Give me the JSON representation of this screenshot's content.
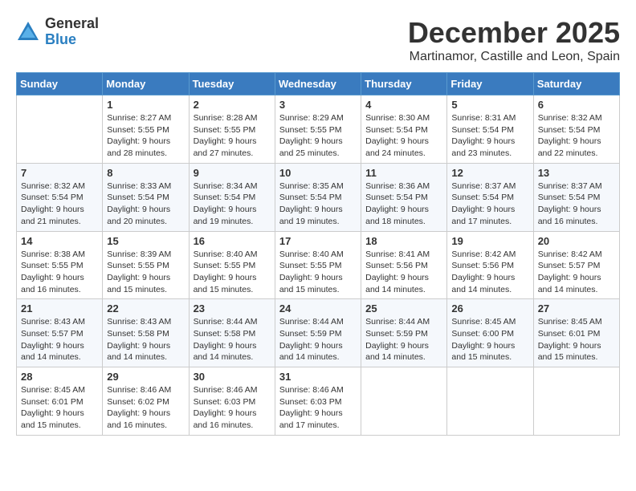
{
  "logo": {
    "general": "General",
    "blue": "Blue"
  },
  "header": {
    "month": "December 2025",
    "location": "Martinamor, Castille and Leon, Spain"
  },
  "days_of_week": [
    "Sunday",
    "Monday",
    "Tuesday",
    "Wednesday",
    "Thursday",
    "Friday",
    "Saturday"
  ],
  "weeks": [
    [
      {
        "day": "",
        "info": ""
      },
      {
        "day": "1",
        "info": "Sunrise: 8:27 AM\nSunset: 5:55 PM\nDaylight: 9 hours and 28 minutes."
      },
      {
        "day": "2",
        "info": "Sunrise: 8:28 AM\nSunset: 5:55 PM\nDaylight: 9 hours and 27 minutes."
      },
      {
        "day": "3",
        "info": "Sunrise: 8:29 AM\nSunset: 5:55 PM\nDaylight: 9 hours and 25 minutes."
      },
      {
        "day": "4",
        "info": "Sunrise: 8:30 AM\nSunset: 5:54 PM\nDaylight: 9 hours and 24 minutes."
      },
      {
        "day": "5",
        "info": "Sunrise: 8:31 AM\nSunset: 5:54 PM\nDaylight: 9 hours and 23 minutes."
      },
      {
        "day": "6",
        "info": "Sunrise: 8:32 AM\nSunset: 5:54 PM\nDaylight: 9 hours and 22 minutes."
      }
    ],
    [
      {
        "day": "7",
        "info": "Sunrise: 8:32 AM\nSunset: 5:54 PM\nDaylight: 9 hours and 21 minutes."
      },
      {
        "day": "8",
        "info": "Sunrise: 8:33 AM\nSunset: 5:54 PM\nDaylight: 9 hours and 20 minutes."
      },
      {
        "day": "9",
        "info": "Sunrise: 8:34 AM\nSunset: 5:54 PM\nDaylight: 9 hours and 19 minutes."
      },
      {
        "day": "10",
        "info": "Sunrise: 8:35 AM\nSunset: 5:54 PM\nDaylight: 9 hours and 19 minutes."
      },
      {
        "day": "11",
        "info": "Sunrise: 8:36 AM\nSunset: 5:54 PM\nDaylight: 9 hours and 18 minutes."
      },
      {
        "day": "12",
        "info": "Sunrise: 8:37 AM\nSunset: 5:54 PM\nDaylight: 9 hours and 17 minutes."
      },
      {
        "day": "13",
        "info": "Sunrise: 8:37 AM\nSunset: 5:54 PM\nDaylight: 9 hours and 16 minutes."
      }
    ],
    [
      {
        "day": "14",
        "info": "Sunrise: 8:38 AM\nSunset: 5:55 PM\nDaylight: 9 hours and 16 minutes."
      },
      {
        "day": "15",
        "info": "Sunrise: 8:39 AM\nSunset: 5:55 PM\nDaylight: 9 hours and 15 minutes."
      },
      {
        "day": "16",
        "info": "Sunrise: 8:40 AM\nSunset: 5:55 PM\nDaylight: 9 hours and 15 minutes."
      },
      {
        "day": "17",
        "info": "Sunrise: 8:40 AM\nSunset: 5:55 PM\nDaylight: 9 hours and 15 minutes."
      },
      {
        "day": "18",
        "info": "Sunrise: 8:41 AM\nSunset: 5:56 PM\nDaylight: 9 hours and 14 minutes."
      },
      {
        "day": "19",
        "info": "Sunrise: 8:42 AM\nSunset: 5:56 PM\nDaylight: 9 hours and 14 minutes."
      },
      {
        "day": "20",
        "info": "Sunrise: 8:42 AM\nSunset: 5:57 PM\nDaylight: 9 hours and 14 minutes."
      }
    ],
    [
      {
        "day": "21",
        "info": "Sunrise: 8:43 AM\nSunset: 5:57 PM\nDaylight: 9 hours and 14 minutes."
      },
      {
        "day": "22",
        "info": "Sunrise: 8:43 AM\nSunset: 5:58 PM\nDaylight: 9 hours and 14 minutes."
      },
      {
        "day": "23",
        "info": "Sunrise: 8:44 AM\nSunset: 5:58 PM\nDaylight: 9 hours and 14 minutes."
      },
      {
        "day": "24",
        "info": "Sunrise: 8:44 AM\nSunset: 5:59 PM\nDaylight: 9 hours and 14 minutes."
      },
      {
        "day": "25",
        "info": "Sunrise: 8:44 AM\nSunset: 5:59 PM\nDaylight: 9 hours and 14 minutes."
      },
      {
        "day": "26",
        "info": "Sunrise: 8:45 AM\nSunset: 6:00 PM\nDaylight: 9 hours and 15 minutes."
      },
      {
        "day": "27",
        "info": "Sunrise: 8:45 AM\nSunset: 6:01 PM\nDaylight: 9 hours and 15 minutes."
      }
    ],
    [
      {
        "day": "28",
        "info": "Sunrise: 8:45 AM\nSunset: 6:01 PM\nDaylight: 9 hours and 15 minutes."
      },
      {
        "day": "29",
        "info": "Sunrise: 8:46 AM\nSunset: 6:02 PM\nDaylight: 9 hours and 16 minutes."
      },
      {
        "day": "30",
        "info": "Sunrise: 8:46 AM\nSunset: 6:03 PM\nDaylight: 9 hours and 16 minutes."
      },
      {
        "day": "31",
        "info": "Sunrise: 8:46 AM\nSunset: 6:03 PM\nDaylight: 9 hours and 17 minutes."
      },
      {
        "day": "",
        "info": ""
      },
      {
        "day": "",
        "info": ""
      },
      {
        "day": "",
        "info": ""
      }
    ]
  ]
}
